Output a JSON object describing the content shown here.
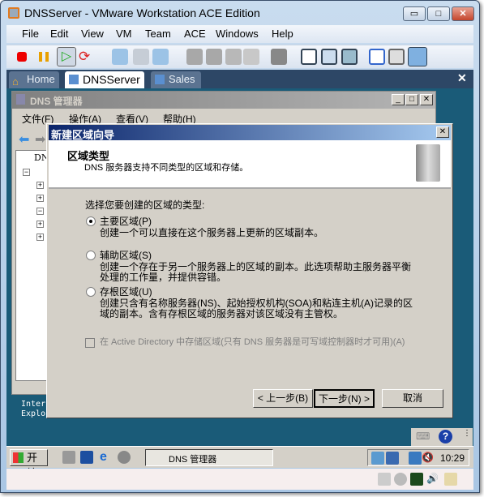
{
  "window": {
    "title": "DNSServer - VMware Workstation ACE Edition",
    "minimize": "▭",
    "maximize": "□",
    "close": "✕"
  },
  "menu": [
    "File",
    "Edit",
    "View",
    "VM",
    "Team",
    "ACE",
    "Windows",
    "Help"
  ],
  "tabs": [
    {
      "label": "Home"
    },
    {
      "label": "DNSServer"
    },
    {
      "label": "Sales"
    }
  ],
  "tab_close": "✕",
  "dns": {
    "title": "DNS 管理器",
    "menu": [
      "文件(F)",
      "操作(A)",
      "查看(V)",
      "帮助(H)"
    ],
    "tree_root": "DNS"
  },
  "wizard": {
    "title": "新建区域向导",
    "close": "✕",
    "heading": "区域类型",
    "subheading": "DNS 服务器支持不同类型的区域和存储。",
    "prompt": "选择您要创建的区域的类型:",
    "options": [
      {
        "label": "主要区域(P)",
        "desc": "创建一个可以直接在这个服务器上更新的区域副本。",
        "selected": true
      },
      {
        "label": "辅助区域(S)",
        "desc": "创建一个存在于另一个服务器上的区域的副本。此选项帮助主服务器平衡处理的工作量，并提供容错。",
        "selected": false
      },
      {
        "label": "存根区域(U)",
        "desc": "创建只含有名称服务器(NS)、起始授权机构(SOA)和粘连主机(A)记录的区域的副本。含有存根区域的服务器对该区域没有主管权。",
        "selected": false
      }
    ],
    "ad_checkbox": {
      "label": "在 Active Directory 中存储区域(只有 DNS 服务器是可写域控制器时才可用)(A)",
      "checked": false,
      "enabled": false
    },
    "buttons": {
      "back": "< 上一步(B)",
      "next": "下一步(N) >",
      "cancel": "取消"
    }
  },
  "desktop": {
    "ie_label": "Internet Explorer"
  },
  "taskbar": {
    "start": "开始",
    "task": "DNS 管理器",
    "clock": "10:29"
  }
}
